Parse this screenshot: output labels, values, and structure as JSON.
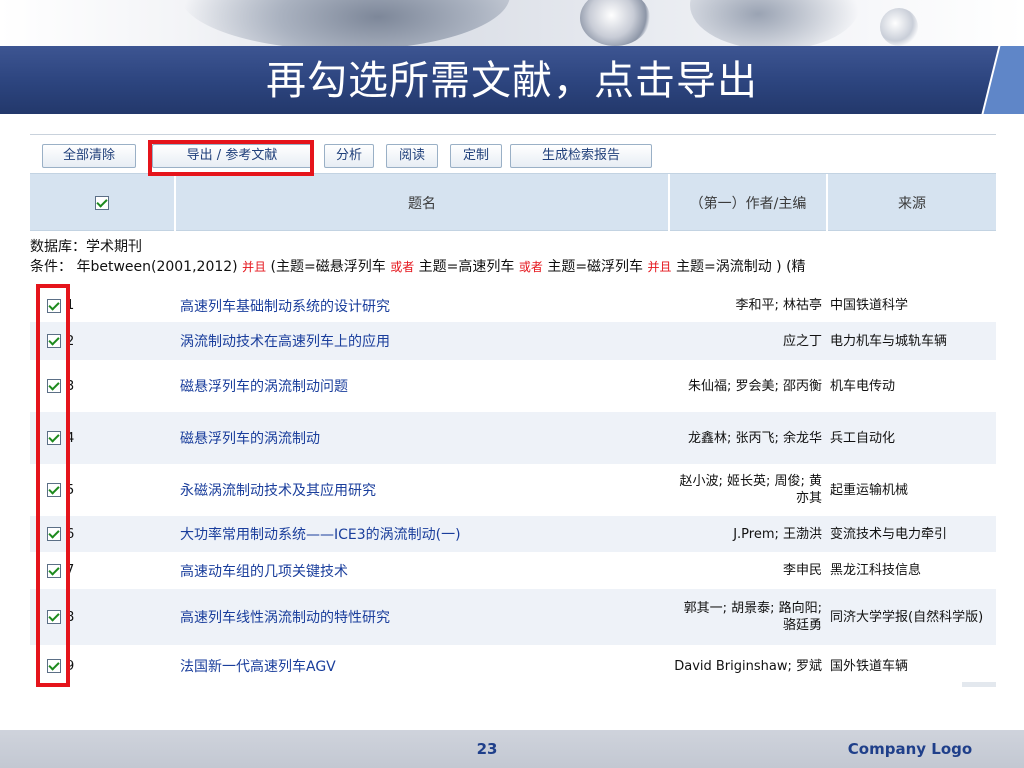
{
  "slide": {
    "title": "再勾选所需文献，点击导出",
    "page_number": "23",
    "logo": "Company Logo"
  },
  "toolbar": {
    "clear_all": "全部清除",
    "export": "导出 / 参考文献",
    "analyze": "分析",
    "read": "阅读",
    "customize": "定制",
    "report": "生成检索报告"
  },
  "table_header": {
    "title": "题名",
    "author": "（第一）作者/主编",
    "source": "来源"
  },
  "search_info": {
    "database_label": "数据库：",
    "database": "学术期刊",
    "condition_label": "条件：",
    "cond_1": "年between(2001,2012)",
    "op_and_1": "并且",
    "cond_2": "(主题=磁悬浮列车",
    "op_or_1": "或者",
    "cond_3": "主题=高速列车",
    "op_or_2": "或者",
    "cond_4": "主题=磁浮列车",
    "op_and_2": "并且",
    "cond_5": "主题=涡流制动",
    "cond_6": ") (精"
  },
  "chart_data": {
    "type": "table",
    "columns": [
      "",
      "题名",
      "（第一）作者/主编",
      "来源"
    ],
    "rows": [
      {
        "num": "1",
        "title": "高速列车基础制动系统的设计研究",
        "author": "李和平; 林祜亭",
        "source": "中国铁道科学",
        "checked": true
      },
      {
        "num": "2",
        "title": "涡流制动技术在高速列车上的应用",
        "author": "应之丁",
        "source": "电力机车与城轨车辆",
        "checked": true
      },
      {
        "num": "3",
        "title": "磁悬浮列车的涡流制动问题",
        "author": "朱仙福; 罗会美; 邵丙衡",
        "source": "机车电传动",
        "checked": true
      },
      {
        "num": "4",
        "title": "磁悬浮列车的涡流制动",
        "author": "龙鑫林; 张丙飞; 余龙华",
        "source": "兵工自动化",
        "checked": true
      },
      {
        "num": "5",
        "title": "永磁涡流制动技术及其应用研究",
        "author": "赵小波; 姬长英; 周俊; 黄亦其",
        "source": "起重运输机械",
        "checked": true
      },
      {
        "num": "6",
        "title": "大功率常用制动系统——ICE3的涡流制动(一)",
        "author": "J.Prem; 王渤洪",
        "source": "变流技术与电力牵引",
        "checked": true
      },
      {
        "num": "7",
        "title": "高速动车组的几项关键技术",
        "author": "李申民",
        "source": "黑龙江科技信息",
        "checked": true
      },
      {
        "num": "8",
        "title": "高速列车线性涡流制动的特性研究",
        "author": "郭其一; 胡景泰; 路向阳; 骆廷勇",
        "source": "同济大学学报(自然科学版)",
        "checked": true
      },
      {
        "num": "9",
        "title": "法国新一代高速列车AGV",
        "author": "David Briginshaw; 罗斌",
        "source": "国外铁道车辆",
        "checked": true
      }
    ]
  }
}
